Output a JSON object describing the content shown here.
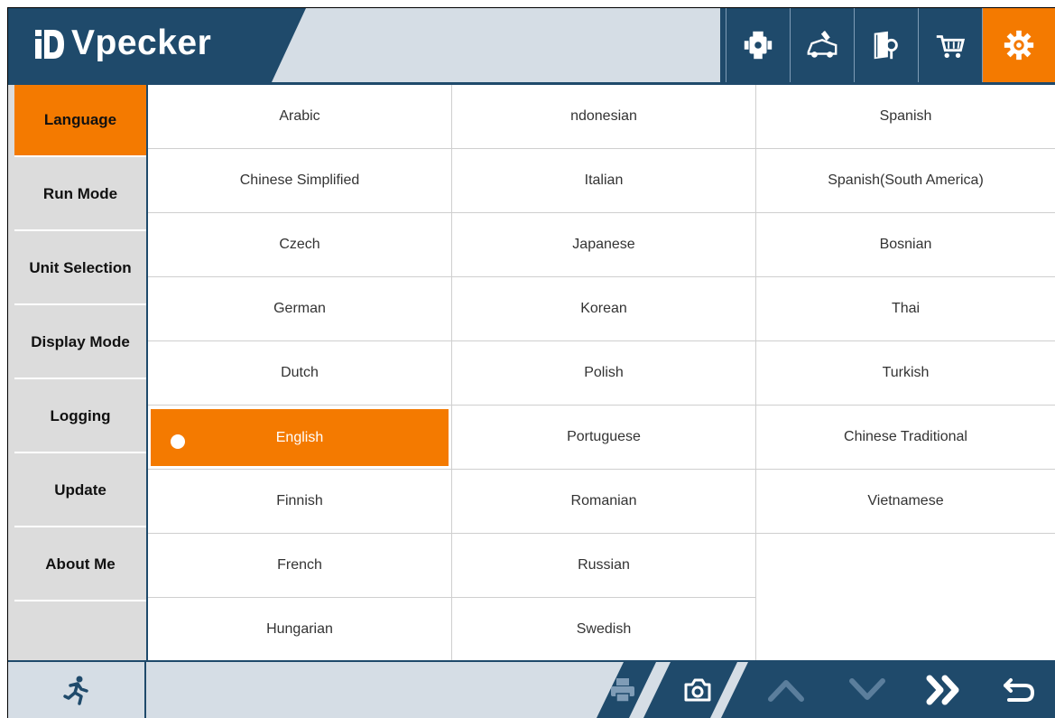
{
  "app": {
    "brand": "Vpecker",
    "accent_color": "#f47a00",
    "dark_color": "#1f4a6b",
    "light_color": "#d5dde5"
  },
  "header": {
    "buttons": [
      {
        "name": "engine-diagnosis-icon"
      },
      {
        "name": "car-service-icon"
      },
      {
        "name": "manual-search-icon"
      },
      {
        "name": "shop-cart-icon"
      },
      {
        "name": "settings-gear-icon",
        "active": true
      }
    ]
  },
  "sidebar": {
    "items": [
      {
        "label": "Language",
        "active": true
      },
      {
        "label": "Run Mode"
      },
      {
        "label": "Unit Selection"
      },
      {
        "label": "Display Mode"
      },
      {
        "label": "Logging"
      },
      {
        "label": "Update"
      },
      {
        "label": "About Me"
      },
      {
        "label": ""
      }
    ]
  },
  "languages": {
    "selected": "English",
    "col1": [
      "Arabic",
      "Chinese Simplified",
      "Czech",
      "German",
      "Dutch",
      "English",
      "Finnish",
      "French",
      "Hungarian"
    ],
    "col2": [
      "ndonesian",
      "Italian",
      "Japanese",
      "Korean",
      "Polish",
      "Portuguese",
      "Romanian",
      "Russian",
      "Swedish"
    ],
    "col3": [
      "Spanish",
      "Spanish(South America)",
      "Bosnian",
      "Thai",
      "Turkish",
      "Chinese Traditional",
      "Vietnamese"
    ]
  },
  "footer": {
    "buttons": [
      {
        "name": "exit-running-man-icon"
      },
      {
        "name": "print-icon",
        "disabled": true
      },
      {
        "name": "camera-screenshot-icon"
      },
      {
        "name": "page-up-icon",
        "disabled": true
      },
      {
        "name": "page-down-icon",
        "disabled": true
      },
      {
        "name": "skip-forward-icon"
      },
      {
        "name": "back-return-icon"
      }
    ]
  }
}
